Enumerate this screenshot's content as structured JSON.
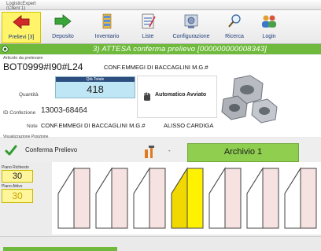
{
  "window": {
    "title": "LogisticExpert (Client 1)",
    "title_extra": "- ..."
  },
  "toolbar": {
    "items": [
      {
        "label": "Prelievi [3]"
      },
      {
        "label": "Deposito"
      },
      {
        "label": "Inventario"
      },
      {
        "label": "Liste"
      },
      {
        "label": "Configurazione"
      },
      {
        "label": "Ricerca"
      },
      {
        "label": "Login"
      }
    ]
  },
  "status": {
    "banner": "3) ATTESA conferma prelievo [000000000008343]"
  },
  "record": {
    "articolo_label": "Articolo da prelevare",
    "articolo_code": "BOT0999#I90#L24",
    "articolo_customer": "CONF.EMMEGI DI BACCAGLINI M.G.#",
    "qty_header": "Qtà Totale",
    "qty_value": "418",
    "quantita_label": "Quantità",
    "conf_label": "ID Confezione",
    "conf_value": "13003-68464",
    "note_label": "Note",
    "note_value": "CONF.EMMEGI DI BACCAGLINI M.G.#",
    "note_extra": "ALISSO CARDIGA",
    "auto_label": "Automatico Avviato"
  },
  "actions": {
    "section_label": "Visualizzazione Posizione",
    "confirm_label": "Conferma Prelievo",
    "dash": "-",
    "archivio_label": "Archivio 1"
  },
  "piano": {
    "richiesto_label": "Piano Richiesto",
    "richiesto_value": "30",
    "attivo_label": "Piano Attivo",
    "attivo_value": "30"
  },
  "colors": {
    "banner": "#6fba3c",
    "highlight": "#fff200",
    "archivio": "#8fce4f",
    "selected_tool": "#fff46a"
  },
  "shelves": {
    "count": 7,
    "active_index": 3
  }
}
